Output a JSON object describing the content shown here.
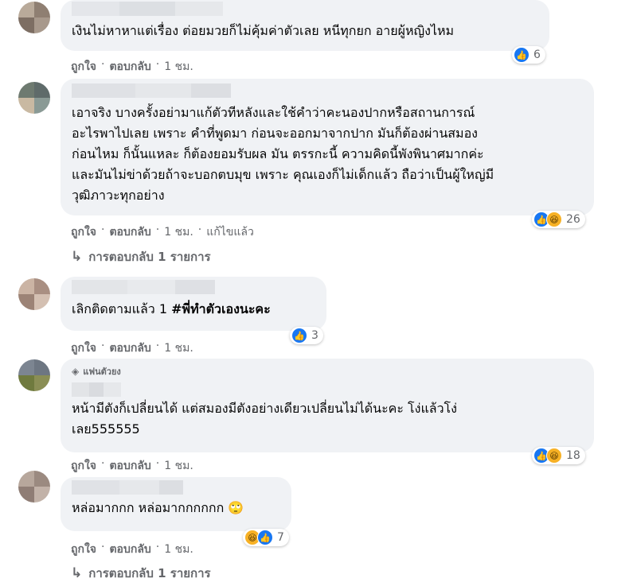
{
  "comments": [
    {
      "text": "เงินไม่หาหาแต่เรื่อง ต่อยมวยก็ไม่คุ้มค่าตัวเลย หนีทุกยก อายผู้หญิงไหม",
      "actions": {
        "like": "ถูกใจ",
        "reply": "ตอบกลับ",
        "time": "1 ชม."
      },
      "reactions": {
        "icons": [
          "like-icon"
        ],
        "count": "6"
      }
    },
    {
      "text": "เอาจริง บางครั้งอย่ามาแก้ตัวทีหลังและใช้คำว่าคะนองปากหรือสถานการณ์\nอะไรพาไปเลย เพราะ คำที่พูดมา ก่อนจะออกมาจากปาก มันก็ต้องผ่านสมอง\nก่อนไหม ก็นั้นแหละ ก็ต้องยอมรับผล มัน ตรรกะนี้ ความคิดนี้พังพินาศมากค่ะ\nและมันไม่ข่าด้วยถ้าจะบอกตบมุข เพราะ คุณเองก็ไม่เด็กแล้ว ถือว่าเป็นผู้ใหญ่มี\nวุฒิภาวะทุกอย่าง",
      "actions": {
        "like": "ถูกใจ",
        "reply": "ตอบกลับ",
        "time": "1 ชม.",
        "edited": "แก้ไขแล้ว"
      },
      "reactions": {
        "icons": [
          "like-icon",
          "haha-icon"
        ],
        "count": "26"
      },
      "replies_label": "การตอบกลับ 1 รายการ"
    },
    {
      "text_plain": "เลิกติดตามแล้ว 1 ",
      "text_bold": "#พี่ทำตัวเองนะคะ",
      "actions": {
        "like": "ถูกใจ",
        "reply": "ตอบกลับ",
        "time": "1 ชม."
      },
      "reactions": {
        "icons": [
          "like-icon"
        ],
        "count": "3"
      }
    },
    {
      "badge": "แฟนตัวยง",
      "text": "หน้ามีตังก็เปลี่ยนได้ แต่สมองมีตังอย่างเดียวเปลี่ยนไม่ได้นะคะ โง่แล้วโง่\nเลย555555",
      "actions": {
        "like": "ถูกใจ",
        "reply": "ตอบกลับ",
        "time": "1 ชม."
      },
      "reactions": {
        "icons": [
          "like-icon",
          "haha-icon"
        ],
        "count": "18"
      }
    },
    {
      "text": "หล่อมากกก หล่อมากกกกกก 🙄",
      "actions": {
        "like": "ถูกใจ",
        "reply": "ตอบกลับ",
        "time": "1 ชม."
      },
      "reactions": {
        "icons": [
          "haha-icon",
          "like-icon"
        ],
        "count": "7"
      },
      "replies_label": "การตอบกลับ 1 รายการ"
    }
  ],
  "colors": {
    "bubble": "#f0f2f5",
    "like": "#1877f2",
    "muted": "#65676b"
  }
}
